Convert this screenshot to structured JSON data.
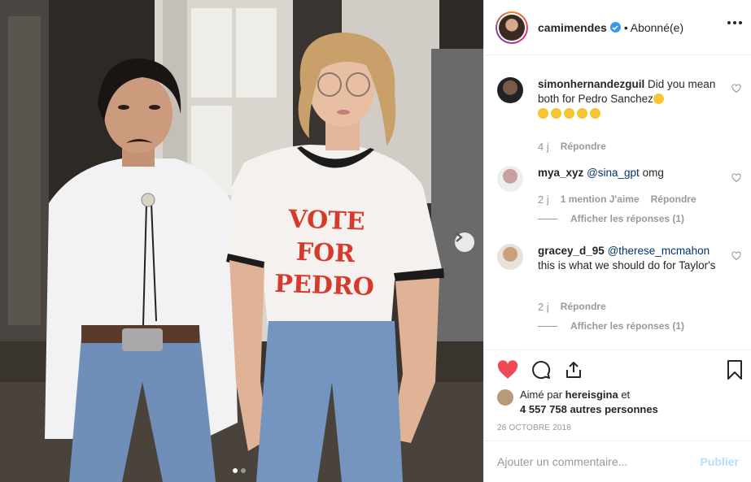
{
  "post": {
    "image_alt": "Two women in costume",
    "shirt_text": [
      "VOTE",
      "FOR",
      "PEDRO"
    ],
    "carousel": {
      "dots": 2,
      "active": 0
    }
  },
  "header": {
    "username": "camimendes",
    "separator": "•",
    "follow_status": "Abonné(e)",
    "verified": true
  },
  "comments": [
    {
      "username": "simonhernandezguil",
      "text": "Did you mean both for Pedro Sanchez",
      "emoji_count": 6,
      "time": "4 j",
      "reply_label": "Répondre"
    },
    {
      "username": "mya_xyz",
      "mention": "@sina_gpt",
      "text": "omg",
      "time": "2 j",
      "likes_label": "1 mention J'aime",
      "reply_label": "Répondre",
      "view_replies": "Afficher les réponses (1)"
    },
    {
      "username": "gracey_d_95",
      "mention": "@therese_mcmahon",
      "text": "this is what we should do for Taylor's",
      "time": "2 j",
      "reply_label": "Répondre",
      "view_replies": "Afficher les réponses (1)"
    }
  ],
  "likes": {
    "prefix": "Aimé par",
    "user": "hereisgina",
    "conjunction": "et",
    "count_text": "4 557 758 autres personnes"
  },
  "date": "28 OCTOBRE 2018",
  "composer": {
    "placeholder": "Ajouter un commentaire...",
    "publish_label": "Publier"
  },
  "colors": {
    "heart": "#ed4956",
    "verified": "#3897f0",
    "publish_disabled": "#b2dffc",
    "mention": "#003569"
  }
}
